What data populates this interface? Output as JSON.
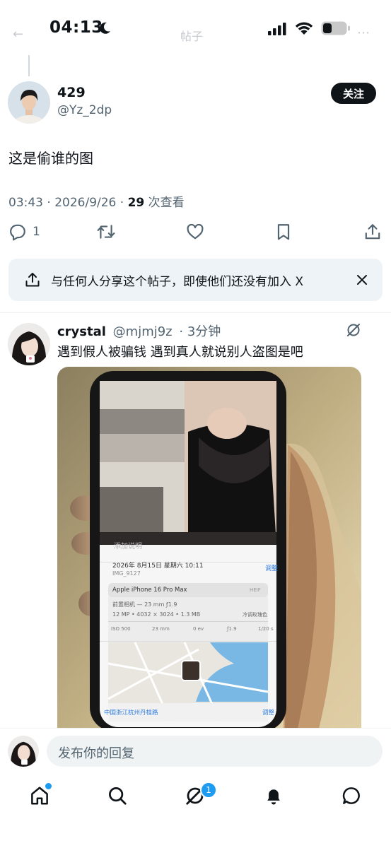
{
  "status": {
    "time": "04:13"
  },
  "header": {
    "title": "帖子"
  },
  "main_post": {
    "author_name": "429",
    "author_handle": "@Yz_2dp",
    "follow_label": "关注",
    "text": "这是偷谁的图",
    "time": "03:43 · 2026/9/26 · ",
    "views_count": "29",
    "views_label": " 次查看",
    "reply_count": "1"
  },
  "share_banner": {
    "text": "与任何人分享这个帖子，即使他们还没有加入 X"
  },
  "reply": {
    "author_name": "crystal",
    "author_handle": "@mjmj9z",
    "time": "· 3分钟",
    "text": "遇到假人被骗钱 遇到真人就说别人盗图是吧"
  },
  "photo_screen": {
    "caption_placeholder": "添加说明",
    "date": "2026年 8月15日 星期六 10:11",
    "adjust": "调整",
    "file_name": "IMG_9127",
    "device": "Apple iPhone 16 Pro Max",
    "format_badge": "HEIF",
    "camera": "前置相机 — 23 mm ƒ1.9",
    "specs": "12 MP • 4032 × 3024 • 1.3 MB",
    "style": "冷调玫瑰色",
    "iso": "ISO 500",
    "focal": "23 mm",
    "ev": "0 ev",
    "aperture": "ƒ1.9",
    "shutter": "1/20 s",
    "location": "中国浙江杭州丹桂路",
    "map_adjust": "调整"
  },
  "composer": {
    "placeholder": "发布你的回复"
  },
  "tabbar": {
    "messages_badge": "1"
  },
  "colors": {
    "accent": "#1d9bf0",
    "text": "#0f1419",
    "muted": "#536471"
  }
}
